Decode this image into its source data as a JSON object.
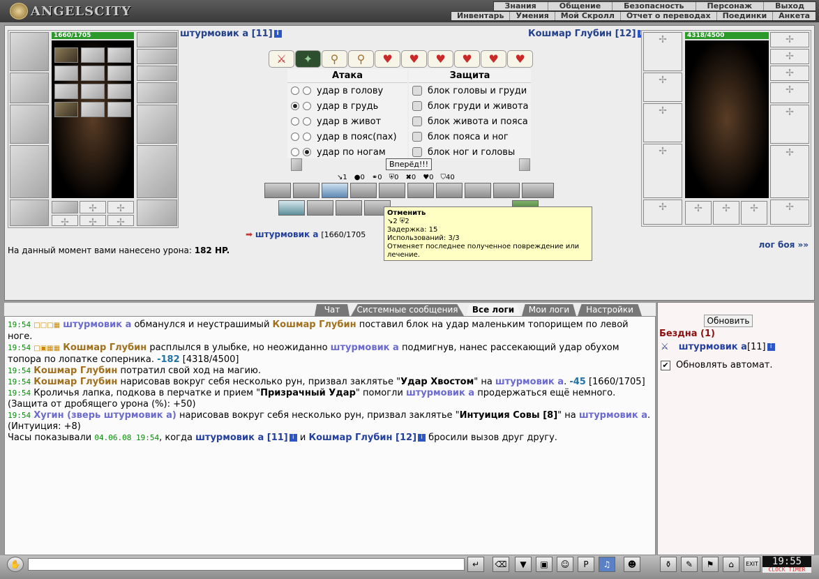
{
  "app": {
    "name": "ANGELSCITY"
  },
  "menu_top": [
    "Знания",
    "Общение",
    "Безопасность",
    "Персонаж",
    "Выход"
  ],
  "menu_sub": [
    "Инвентарь",
    "Умения",
    "Мой Скролл",
    "Отчет о переводах",
    "Поединки",
    "Анкета"
  ],
  "player": {
    "name": "штурмовик а [11]",
    "hp": "1660/1705"
  },
  "enemy": {
    "name": "Кошмар Глубин [12]",
    "hp": "4318/4500"
  },
  "attack": {
    "title": "Атака",
    "options": [
      "удар в голову",
      "удар в грудь",
      "удар в живот",
      "удар в пояс(пах)",
      "удар по ногам"
    ]
  },
  "defense": {
    "title": "Защита",
    "options": [
      "блок головы и груди",
      "блок груди и живота",
      "блок живота и пояса",
      "блок пояса и ног",
      "блок ног и головы"
    ]
  },
  "forward_button": "Вперёд!!!",
  "stats": [
    "↘1",
    "●0",
    "⚭0",
    "⛨0",
    "✖0",
    "♥0",
    "⛉40"
  ],
  "tooltip": {
    "title": "Отменить",
    "line1": "↘2  ⛨2",
    "line2": "Задержка: 15",
    "line3": "Использований: 3/3",
    "line4": "Отменяет последнее полученное повреждение или лечение."
  },
  "target": {
    "name": "штурмовик а",
    "hp": "[1660/1705"
  },
  "damage": {
    "text": "На данный момент вами нанесено урона:",
    "value": "182 HP."
  },
  "log_link": "лог боя »»",
  "tabs": [
    "Чат",
    "Системные сообщения",
    "Все логи",
    "Мои логи",
    "Настройки"
  ],
  "log": {
    "l1_time": "19:54",
    "l1_a": "штурмовик а",
    "l1_t1": " обманулся и неустрашимый ",
    "l1_b": "Кошмар Глубин",
    "l1_t2": " поставил блок на удар маленьким топорищем по левой ноге.",
    "l2_time": "19:54",
    "l2_a": "Кошмар Глубин",
    "l2_t1": " расплылся в улыбке, но неожиданно ",
    "l2_b": "штурмовик а",
    "l2_t2": " подмигнув, нанес рассекающий удар обухом топора по лопатке соперника. ",
    "l2_num": "-182",
    "l2_hp": " [4318/4500]",
    "l3_time": "19:54",
    "l3_a": "Кошмар Глубин",
    "l3_t1": " потратил свой ход на магию.",
    "l4_time": "19:54",
    "l4_a": "Кошмар Глубин",
    "l4_t1": " нарисовав вокруг себя несколько рун, призвал заклятье \"",
    "l4_spell": "Удар Хвостом",
    "l4_t2": "\" на ",
    "l4_b": "штурмовик а",
    "l4_t3": ". ",
    "l4_num": "-45",
    "l4_hp": " [1660/1705]",
    "l5_time": "19:54",
    "l5_t1": " Кроличья лапка, подкова в перчатке и прием \"",
    "l5_spell": "Призрачный Удар",
    "l5_t2": "\" помогли ",
    "l5_b": "штурмовик а",
    "l5_t3": " продержаться ещё немного. (Защита от дробящего урона (%): +50)",
    "l6_time": "19:54",
    "l6_a": "Хугин (зверь штурмовик а)",
    "l6_t1": " нарисовав вокруг себя несколько рун, призвал заклятье \"",
    "l6_spell": "Интуиция Совы [8]",
    "l6_t2": "\" на ",
    "l6_b": "штурмовик а",
    "l6_t3": ". (Интуиция: +8)",
    "l7_t1": "Часы показывали ",
    "l7_date": "04.06.08 19:54",
    "l7_t2": ", когда ",
    "l7_a": "штурмовик а [11]",
    "l7_t3": " и ",
    "l7_b": "Кошмар Глубин [12]",
    "l7_t4": " бросили вызов друг другу."
  },
  "side": {
    "refresh": "Обновить",
    "location": "Бездна (1)",
    "player": "штурмовик а",
    "level": "[11]",
    "auto": "Обновлять автомат."
  },
  "clock": {
    "time": "19:55",
    "label": "CLOCK TIMER"
  }
}
